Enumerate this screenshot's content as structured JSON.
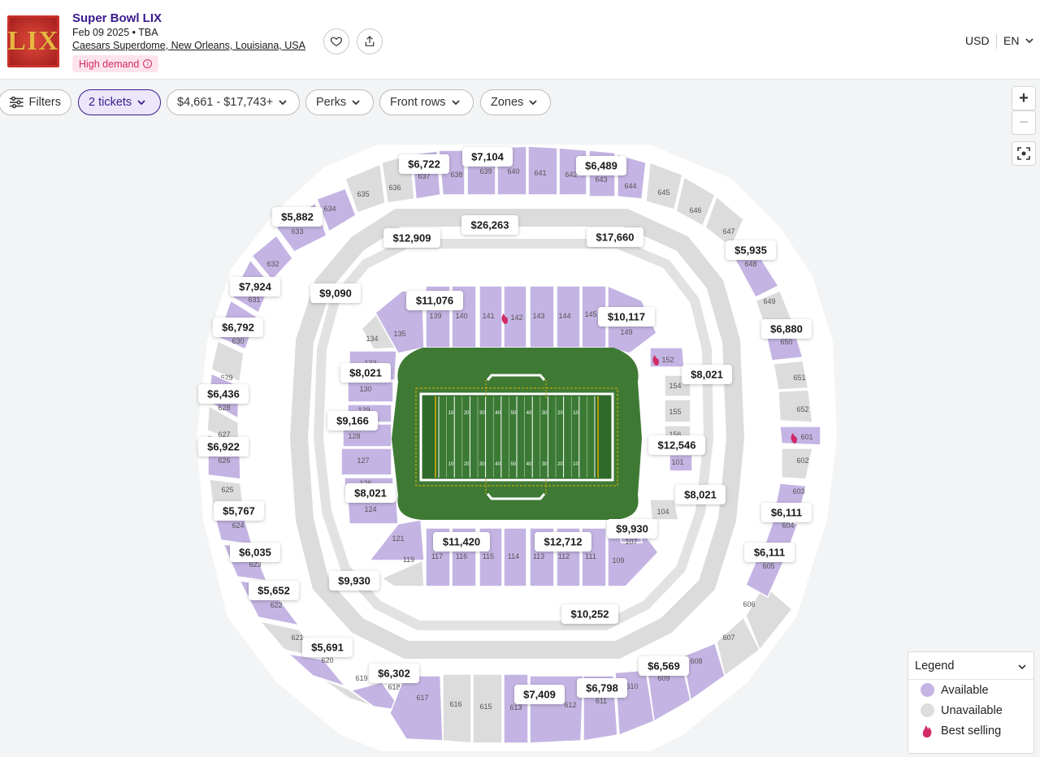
{
  "event": {
    "logo_text": "LIX",
    "title": "Super Bowl LIX",
    "date": "Feb 09 2025 • TBA",
    "venue": "Caesars Superdome, New Orleans, Louisiana, USA",
    "badge": "High demand",
    "favorite_icon": "heart-icon",
    "share_icon": "share-icon"
  },
  "header_right": {
    "currency": "USD",
    "language": "EN"
  },
  "filters": {
    "filters_label": "Filters",
    "tickets_label": "2 tickets",
    "price_label": "$4,661 - $17,743+",
    "perks_label": "Perks",
    "front_rows_label": "Front rows",
    "zones_label": "Zones"
  },
  "zoom": {
    "in": "+",
    "out": "−"
  },
  "legend": {
    "title": "Legend",
    "items": [
      {
        "label": "Available",
        "color": "#c4b4e3"
      },
      {
        "label": "Unavailable",
        "color": "#dddddd"
      },
      {
        "label": "Best selling",
        "color": "#d12a66"
      }
    ]
  },
  "colors": {
    "available": "#c4b4e3",
    "unavailable": "#dcdcdc",
    "field": "#3f7a35",
    "accent": "#3b1a8c",
    "best": "#d12a66"
  },
  "price_tags": [
    {
      "label": "$6,722"
    },
    {
      "label": "$7,104"
    },
    {
      "label": "$6,489"
    },
    {
      "label": "$5,882"
    },
    {
      "label": "$26,263"
    },
    {
      "label": "$12,909"
    },
    {
      "label": "$17,660"
    },
    {
      "label": "$5,935"
    },
    {
      "label": "$7,924"
    },
    {
      "label": "$9,090"
    },
    {
      "label": "$11,076"
    },
    {
      "label": "$10,117"
    },
    {
      "label": "$6,792"
    },
    {
      "label": "$6,880"
    },
    {
      "label": "$8,021"
    },
    {
      "label": "$8,021"
    },
    {
      "label": "$6,436"
    },
    {
      "label": "$9,166"
    },
    {
      "label": "$6,922"
    },
    {
      "label": "$12,546"
    },
    {
      "label": "$8,021"
    },
    {
      "label": "$8,021"
    },
    {
      "label": "$5,767"
    },
    {
      "label": "$6,111"
    },
    {
      "label": "$11,420"
    },
    {
      "label": "$12,712"
    },
    {
      "label": "$9,930"
    },
    {
      "label": "$6,035"
    },
    {
      "label": "$6,111"
    },
    {
      "label": "$5,652"
    },
    {
      "label": "$9,930"
    },
    {
      "label": "$10,252"
    },
    {
      "label": "$5,691"
    },
    {
      "label": "$6,302"
    },
    {
      "label": "$6,569"
    },
    {
      "label": "$7,409"
    },
    {
      "label": "$6,798"
    }
  ],
  "sections": {
    "upper_available": [
      {
        "label": "638"
      },
      {
        "label": "639"
      },
      {
        "label": "640"
      },
      {
        "label": "641"
      },
      {
        "label": "642"
      },
      {
        "label": "643"
      },
      {
        "label": "644"
      },
      {
        "label": "634"
      },
      {
        "label": "633"
      },
      {
        "label": "632"
      },
      {
        "label": "631"
      },
      {
        "label": "630"
      },
      {
        "label": "628"
      },
      {
        "label": "626"
      },
      {
        "label": "624"
      },
      {
        "label": "623"
      },
      {
        "label": "622"
      },
      {
        "label": "620"
      },
      {
        "label": "618"
      },
      {
        "label": "617"
      },
      {
        "label": "613"
      },
      {
        "label": "612"
      },
      {
        "label": "611"
      },
      {
        "label": "610"
      },
      {
        "label": "609"
      },
      {
        "label": "608"
      },
      {
        "label": "605"
      },
      {
        "label": "604"
      },
      {
        "label": "603"
      },
      {
        "label": "601"
      },
      {
        "label": "650"
      },
      {
        "label": "648"
      }
    ],
    "upper_unavailable": [
      {
        "label": "635"
      },
      {
        "label": "636"
      },
      {
        "label": "645"
      },
      {
        "label": "646"
      },
      {
        "label": "647"
      },
      {
        "label": "649"
      },
      {
        "label": "651"
      },
      {
        "label": "652"
      },
      {
        "label": "602"
      },
      {
        "label": "629"
      },
      {
        "label": "627"
      },
      {
        "label": "625"
      },
      {
        "label": "621"
      },
      {
        "label": "619"
      },
      {
        "label": "616"
      },
      {
        "label": "615"
      },
      {
        "label": "614"
      },
      {
        "label": "606"
      },
      {
        "label": "607"
      }
    ],
    "lower_available": [
      {
        "label": "139"
      },
      {
        "label": "140"
      },
      {
        "label": "141"
      },
      {
        "label": "142"
      },
      {
        "label": "143"
      },
      {
        "label": "144"
      },
      {
        "label": "145"
      },
      {
        "label": "149"
      },
      {
        "label": "135"
      },
      {
        "label": "133"
      },
      {
        "label": "130"
      },
      {
        "label": "129"
      },
      {
        "label": "128"
      },
      {
        "label": "127"
      },
      {
        "label": "126"
      },
      {
        "label": "124"
      },
      {
        "label": "121"
      },
      {
        "label": "117"
      },
      {
        "label": "116"
      },
      {
        "label": "115"
      },
      {
        "label": "114"
      },
      {
        "label": "113"
      },
      {
        "label": "112"
      },
      {
        "label": "111"
      },
      {
        "label": "109"
      },
      {
        "label": "107"
      },
      {
        "label": "101"
      },
      {
        "label": "152"
      }
    ],
    "lower_unavailable": [
      {
        "label": "134"
      },
      {
        "label": "119"
      },
      {
        "label": "104"
      },
      {
        "label": "154"
      },
      {
        "label": "155"
      },
      {
        "label": "156"
      }
    ]
  },
  "field": {
    "yard_numbers": [
      "10",
      "20",
      "30",
      "40",
      "50",
      "40",
      "30",
      "20",
      "10"
    ]
  }
}
